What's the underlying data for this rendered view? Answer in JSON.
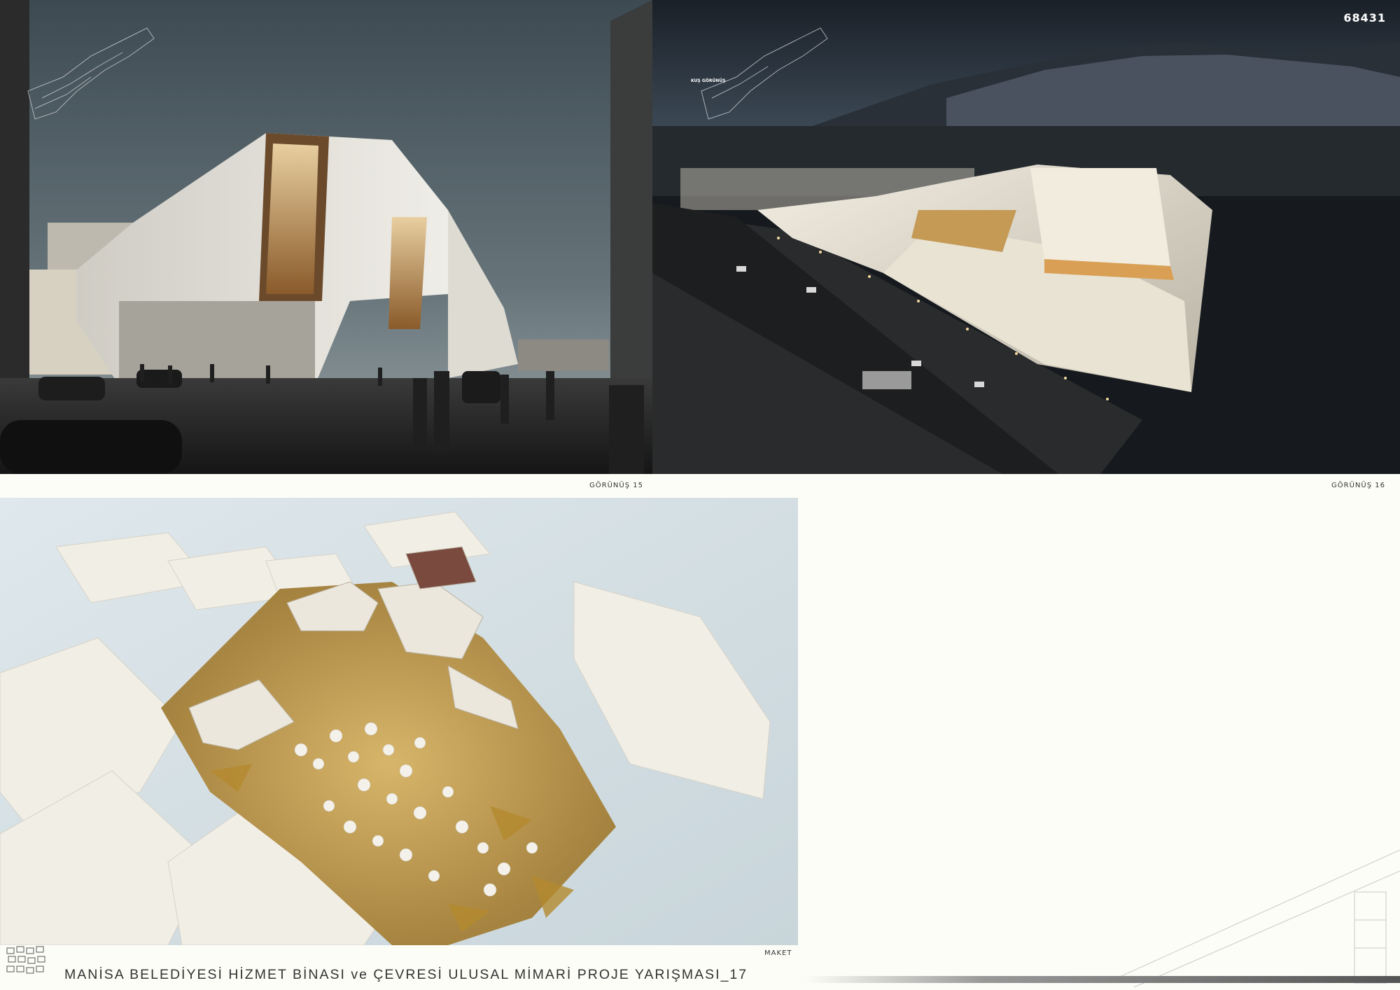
{
  "sheet": {
    "number": "68431",
    "title": "MANİSA BELEDİYESİ HİZMET BİNASI ve ÇEVRESİ ULUSAL MİMARİ PROJE YARIŞMASI_17"
  },
  "views": [
    {
      "caption": "GÖRÜNÜŞ 15"
    },
    {
      "caption": "GÖRÜNÜŞ 16",
      "keymap_label": "KUŞ GÖRÜNÜŞ"
    },
    {
      "caption": "MAKET"
    }
  ],
  "colors": {
    "paper": "#fdfdf8",
    "sky_day": "#4a5a62",
    "sky_night": "#1c2530",
    "building_white": "#e8e6e0",
    "glow_amber": "#d9a055",
    "model_gold": "#c9a04a"
  }
}
